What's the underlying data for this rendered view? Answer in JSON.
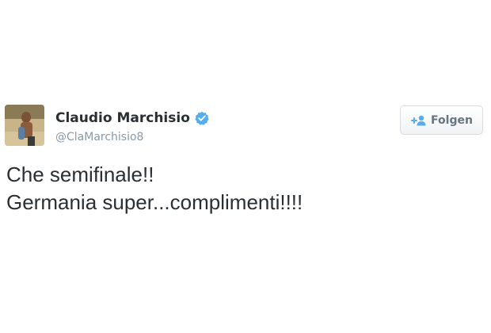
{
  "tweet": {
    "author": {
      "name": "Claudio Marchisio",
      "handle": "@ClaMarchisio8",
      "verified": true,
      "avatar": "avatar-photo"
    },
    "follow_button": {
      "label": "Folgen",
      "icon": "follow-user-icon"
    },
    "text_lines": [
      "Che semifinale!!",
      "Germania super...complimenti!!!!"
    ]
  },
  "colors": {
    "text": "#292f33",
    "handle": "#8899a6",
    "verified_badge": "#55acee",
    "button_text": "#66757f",
    "button_border": "#d6dde2"
  }
}
